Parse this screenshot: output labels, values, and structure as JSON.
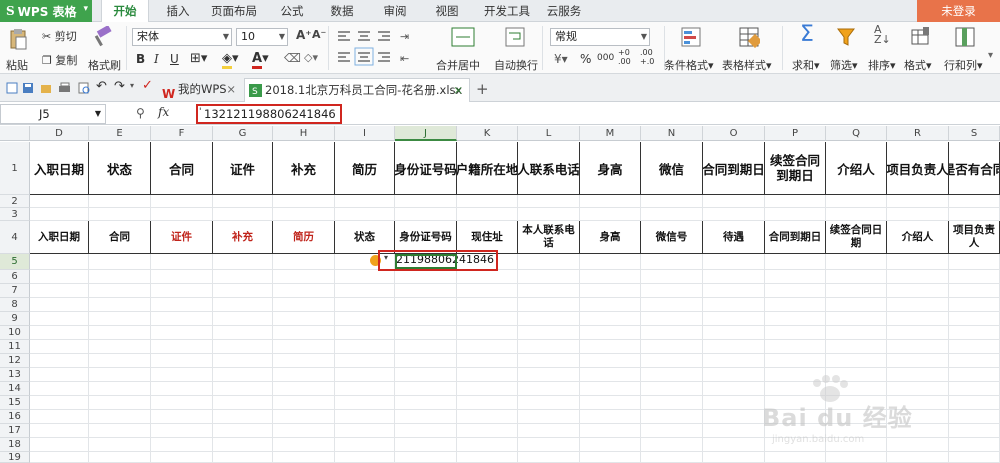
{
  "app": {
    "name": "WPS 表格",
    "logo": "S"
  },
  "menu": {
    "tabs": [
      "开始",
      "插入",
      "页面布局",
      "公式",
      "数据",
      "审阅",
      "视图",
      "开发工具",
      "云服务"
    ],
    "active": "开始",
    "login": "未登录"
  },
  "ribbon": {
    "paste": "粘贴",
    "cut": "剪切",
    "copy": "复制",
    "format_painter": "格式刷",
    "font": "宋体",
    "size": "10",
    "bold": "B",
    "italic": "I",
    "underline": "U",
    "merge_center": "合并居中",
    "auto_wrap": "自动换行",
    "number_format": "常规",
    "percent": "%",
    "thousands": "000",
    "inc_decimal": "+0 .00",
    "dec_decimal": ".00 +.0",
    "cond_format": "条件格式",
    "table_style": "表格样式",
    "sum": "求和",
    "filter": "筛选",
    "sort": "排序",
    "format": "格式",
    "rows_cols": "行和列"
  },
  "doctabs": {
    "home": "我的WPS",
    "file": "2018.1北京万科员工合同-花名册.xlsx *",
    "add": "+"
  },
  "formula_bar": {
    "cell_ref": "J5",
    "fx": "fx",
    "value": "132121198806241846",
    "apostrophe": "'"
  },
  "grid": {
    "columns": [
      "D",
      "E",
      "F",
      "G",
      "H",
      "I",
      "J",
      "K",
      "L",
      "M",
      "N",
      "O",
      "P",
      "Q",
      "R",
      "S"
    ],
    "selected_column": "J",
    "rows": [
      "1",
      "2",
      "3",
      "4",
      "5",
      "6",
      "7",
      "8",
      "9",
      "10",
      "11",
      "12",
      "13",
      "14",
      "15",
      "16",
      "17",
      "18",
      "19"
    ],
    "selected_row": "5",
    "row1": [
      "入职日期",
      "状态",
      "合同",
      "证件",
      "补充",
      "简历",
      "身份证号码",
      "户籍所在地",
      "人联系电话",
      "身高",
      "微信",
      "合同到期日",
      "续签合同到期日",
      "介绍人",
      "项目负责人",
      "是否有合同"
    ],
    "row4": [
      "入职日期",
      "合同",
      "证件",
      "补充",
      "简历",
      "状态",
      "身份证号码",
      "现住址",
      "本人联系电话",
      "身高",
      "微信号",
      "待遇",
      "合同到期日",
      "续签合同日期",
      "介绍人",
      "项目负责人"
    ],
    "row4_red_indices": [
      2,
      3,
      4
    ],
    "j5_display": "21198806241846",
    "status_colors": {
      "selected_border": "#2f7d32",
      "highlight": "#d0261f",
      "error_icon": "#f0a21c"
    }
  },
  "watermark": {
    "brand": "Bai du 经验",
    "url": "jingyan.baidu.com"
  }
}
